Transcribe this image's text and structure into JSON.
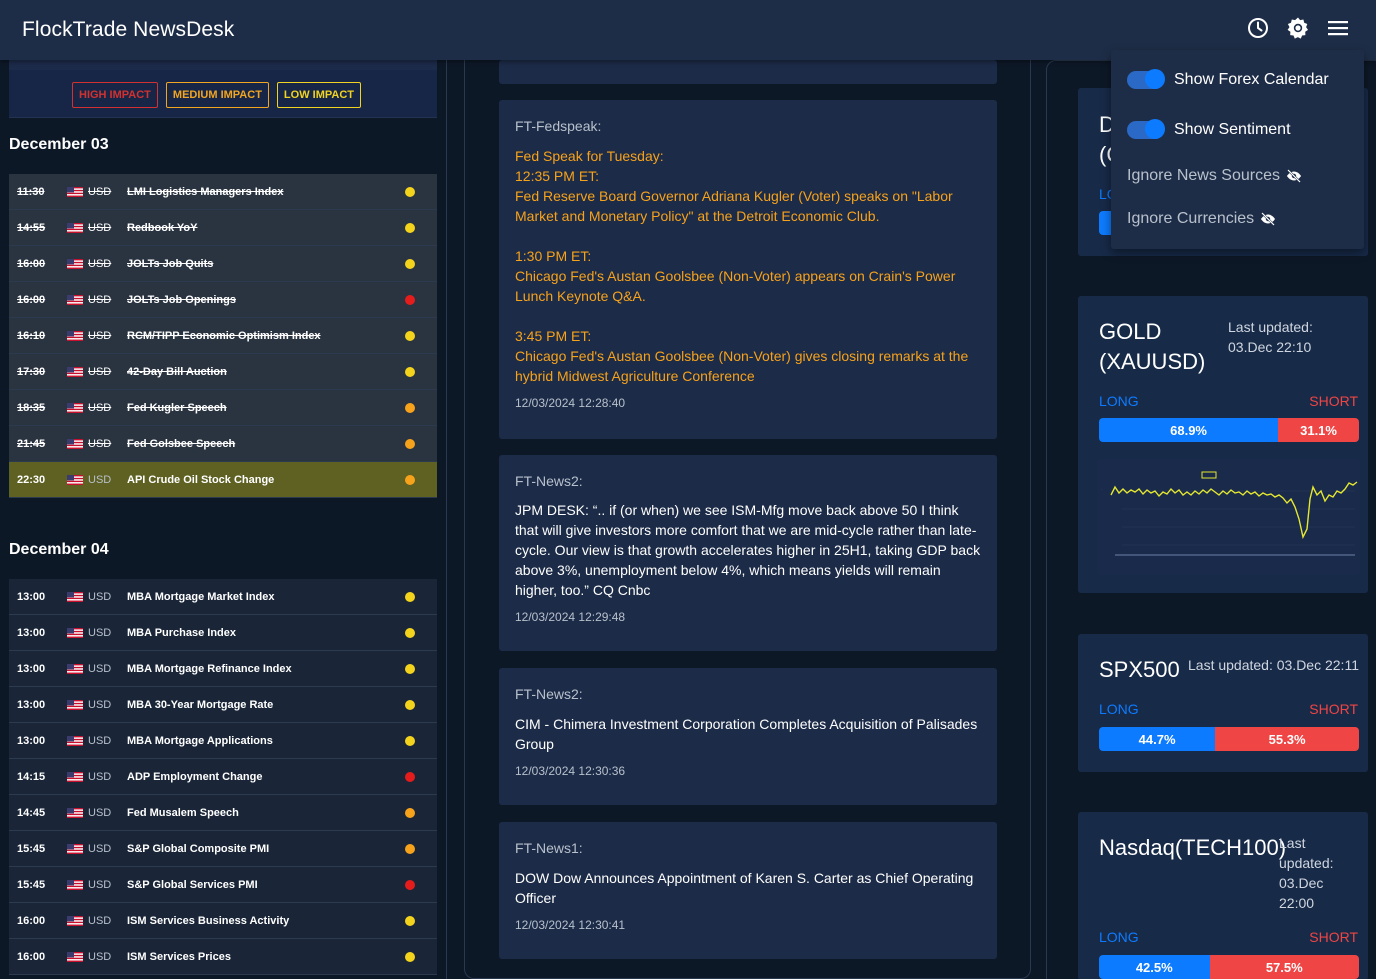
{
  "header": {
    "title": "FlockTrade NewsDesk",
    "icons": [
      "clock-icon",
      "gear-icon",
      "menu-icon"
    ]
  },
  "impact_filters": {
    "high": "HIGH IMPACT",
    "medium": "MEDIUM IMPACT",
    "low": "LOW IMPACT"
  },
  "colors": {
    "high": "#e51c1c",
    "medium": "#f7a21b",
    "low": "#f3d31c",
    "long": "#0d7bff",
    "short": "#ef4545",
    "news_orange": "#f7a21b"
  },
  "calendar": {
    "day1": {
      "heading": "December 03",
      "events": [
        {
          "time": "11:30",
          "cur": "USD",
          "name": "LMI Logistics Managers Index",
          "impact": "low",
          "state": "past"
        },
        {
          "time": "14:55",
          "cur": "USD",
          "name": "Redbook YoY",
          "impact": "low",
          "state": "past"
        },
        {
          "time": "16:00",
          "cur": "USD",
          "name": "JOLTs Job Quits",
          "impact": "low",
          "state": "past"
        },
        {
          "time": "16:00",
          "cur": "USD",
          "name": "JOLTs Job Openings",
          "impact": "high",
          "state": "past"
        },
        {
          "time": "16:10",
          "cur": "USD",
          "name": "RCM/TIPP Economic Optimism Index",
          "impact": "low",
          "state": "past"
        },
        {
          "time": "17:30",
          "cur": "USD",
          "name": "42-Day Bill Auction",
          "impact": "low",
          "state": "past"
        },
        {
          "time": "18:35",
          "cur": "USD",
          "name": "Fed Kugler Speech",
          "impact": "medium",
          "state": "past"
        },
        {
          "time": "21:45",
          "cur": "USD",
          "name": "Fed Golsbee Speech",
          "impact": "medium",
          "state": "past"
        },
        {
          "time": "22:30",
          "cur": "USD",
          "name": "API Crude Oil Stock Change",
          "impact": "medium",
          "state": "current"
        }
      ]
    },
    "day2": {
      "heading": "December 04",
      "events": [
        {
          "time": "13:00",
          "cur": "USD",
          "name": "MBA Mortgage Market Index",
          "impact": "low",
          "state": "upcoming"
        },
        {
          "time": "13:00",
          "cur": "USD",
          "name": "MBA Purchase Index",
          "impact": "low",
          "state": "upcoming"
        },
        {
          "time": "13:00",
          "cur": "USD",
          "name": "MBA Mortgage Refinance Index",
          "impact": "low",
          "state": "upcoming"
        },
        {
          "time": "13:00",
          "cur": "USD",
          "name": "MBA 30-Year Mortgage Rate",
          "impact": "low",
          "state": "upcoming"
        },
        {
          "time": "13:00",
          "cur": "USD",
          "name": "MBA Mortgage Applications",
          "impact": "low",
          "state": "upcoming"
        },
        {
          "time": "14:15",
          "cur": "USD",
          "name": "ADP Employment Change",
          "impact": "high",
          "state": "upcoming"
        },
        {
          "time": "14:45",
          "cur": "USD",
          "name": "Fed Musalem Speech",
          "impact": "medium",
          "state": "upcoming"
        },
        {
          "time": "15:45",
          "cur": "USD",
          "name": "S&P Global Composite PMI",
          "impact": "medium",
          "state": "upcoming"
        },
        {
          "time": "15:45",
          "cur": "USD",
          "name": "S&P Global Services PMI",
          "impact": "high",
          "state": "upcoming"
        },
        {
          "time": "16:00",
          "cur": "USD",
          "name": "ISM Services Business Activity",
          "impact": "low",
          "state": "upcoming"
        },
        {
          "time": "16:00",
          "cur": "USD",
          "name": "ISM Services Prices",
          "impact": "low",
          "state": "upcoming"
        }
      ]
    }
  },
  "news": [
    {
      "source": "FT-Fedspeak:",
      "style": "orange",
      "body": "Fed Speak for Tuesday:\n12:35 PM ET:\nFed Reserve Board Governor Adriana Kugler (Voter) speaks on \"Labor Market and Monetary Policy\" at the Detroit Economic Club.\n\n1:30 PM ET:\nChicago Fed's Austan Goolsbee (Non-Voter) appears on Crain's Power Lunch Keynote Q&A.\n\n3:45 PM ET:\nChicago Fed's Austan Goolsbee (Non-Voter) gives closing remarks at the hybrid Midwest Agriculture Conference",
      "timestamp": "12/03/2024 12:28:40"
    },
    {
      "source": "FT-News2:",
      "style": "white",
      "body": "JPM DESK: “.. if (or when) we see ISM-Mfg move back above 50 I think that will give investors more comfort that we are mid-cycle rather than late-cycle. Our view is that growth accelerates higher in 25H1, taking GDP back above 3%, unemployment below 4%, which means yields will remain higher, too.” CQ Cnbc",
      "timestamp": "12/03/2024 12:29:48"
    },
    {
      "source": "FT-News2:",
      "style": "white",
      "body": "CIM - Chimera Investment Corporation Completes Acquisition of Palisades Group",
      "timestamp": "12/03/2024 12:30:36"
    },
    {
      "source": "FT-News1:",
      "style": "white",
      "body": "DOW Dow Announces Appointment of Karen S. Carter as Chief Operating Officer",
      "timestamp": "12/03/2024 12:30:41"
    }
  ],
  "sentiment": {
    "partial": {
      "name_fragment": "D\n(C",
      "long_fragment": "LO"
    },
    "gold": {
      "name": "GOLD\n(XAUUSD)",
      "updated": "Last updated:\n03.Dec 22:10",
      "long_label": "LONG",
      "short_label": "SHORT",
      "long_pct": "68.9%",
      "short_pct": "31.1%",
      "long_value": 68.9
    },
    "spx": {
      "name": "SPX500",
      "updated": "Last updated: 03.Dec 22:11",
      "long_label": "LONG",
      "short_label": "SHORT",
      "long_pct": "44.7%",
      "short_pct": "55.3%",
      "long_value": 44.7
    },
    "nasdaq": {
      "name": "Nasdaq(TECH100)",
      "updated": "Last\nupdated:\n03.Dec\n22:00",
      "long_label": "LONG",
      "short_label": "SHORT",
      "long_pct": "42.5%",
      "short_pct": "57.5%",
      "long_value": 42.5
    }
  },
  "dropdown": {
    "items": [
      {
        "label": "Show Forex Calendar",
        "type": "toggle",
        "on": true
      },
      {
        "label": "Show Sentiment",
        "type": "toggle",
        "on": true
      },
      {
        "label": "Ignore News Sources",
        "type": "eye-off"
      },
      {
        "label": "Ignore Currencies",
        "type": "eye-off"
      }
    ]
  }
}
